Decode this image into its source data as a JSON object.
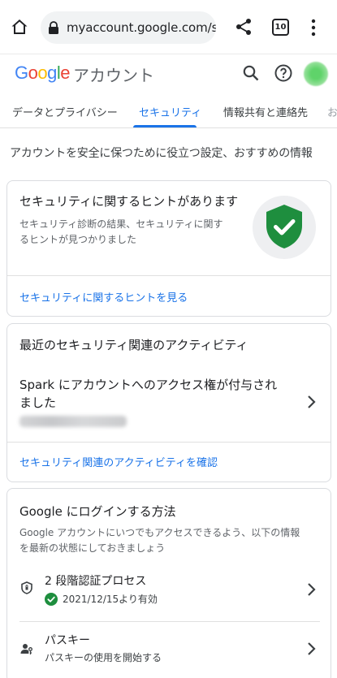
{
  "browser": {
    "url": "myaccount.google.com/sec",
    "tab_count": "10",
    "icons": [
      "home-icon",
      "lock-icon",
      "share-icon",
      "tabs-icon",
      "more-vert-icon"
    ]
  },
  "header": {
    "logo_letters": [
      "G",
      "o",
      "o",
      "g",
      "l",
      "e"
    ],
    "logo_colors": [
      "#4285F4",
      "#EA4335",
      "#FBBC05",
      "#4285F4",
      "#34A853",
      "#EA4335"
    ],
    "account_label": "アカウント"
  },
  "tabs": [
    {
      "label": "データとプライバシー"
    },
    {
      "label": "セキュリティ",
      "active": true
    },
    {
      "label": "情報共有と連絡先"
    },
    {
      "label": "お"
    }
  ],
  "intro": "アカウントを安全に保つために役立つ設定、おすすめの情報",
  "tips_card": {
    "title": "セキュリティに関するヒントがあります",
    "desc_line1": "セキュリティ診断の結果、セキュリティに関す",
    "desc_line2": "るヒントが見つかりました",
    "link": "セキュリティに関するヒントを見る",
    "shield_color": "#1e8e3e"
  },
  "activity_card": {
    "title": "最近のセキュリティ関連のアクティビティ",
    "item_line1": "Spark にアカウントへのアクセス権が付与され",
    "item_line2": "ました",
    "link": "セキュリティ関連のアクティビティを確認"
  },
  "signin_card": {
    "title": "Google にログインする方法",
    "desc_line1": "Google アカウントにいつでもアクセスできるよう、以下の情報",
    "desc_line2": "を最新の状態にしておきましょう",
    "items": [
      {
        "label": "2 段階認証プロセス",
        "sub": "2021/12/15より有効",
        "icon": "shield-icon",
        "status": "ok"
      },
      {
        "label": "パスキー",
        "sub": "パスキーの使用を開始する",
        "icon": "passkey-icon"
      }
    ]
  },
  "colors": {
    "accent": "#1a73e8",
    "success": "#1e8e3e"
  }
}
